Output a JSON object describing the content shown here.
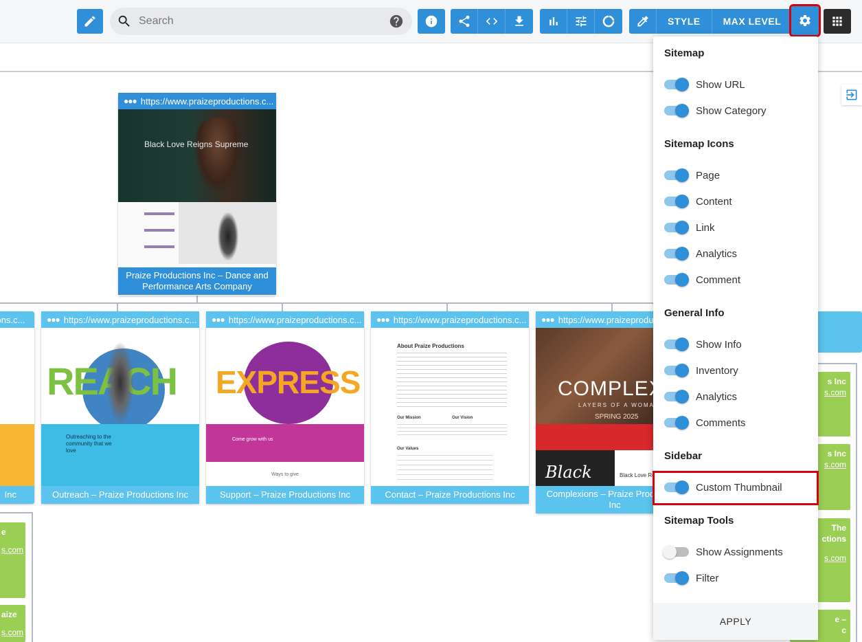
{
  "toolbar": {
    "search_placeholder": "Search",
    "style_label": "STYLE",
    "max_level_label": "MAX LEVEL"
  },
  "root": {
    "url": "https://www.praizeproductions.c...",
    "title": "Praize Productions Inc – Dance and Performance Arts Company",
    "hero_text": "Black Love Reigns Supreme"
  },
  "children": [
    {
      "url": "tions.c...",
      "title": "Inc"
    },
    {
      "url": "https://www.praizeproductions.c...",
      "title": "Outreach – Praize Productions Inc",
      "hero_text": "REACH",
      "sub_text": "Outreaching to the community that we love"
    },
    {
      "url": "https://www.praizeproductions.c...",
      "title": "Support – Praize Productions Inc",
      "hero_text": "EXPRESS",
      "sub_text": "Come grow with us",
      "footer_text": "Ways to give"
    },
    {
      "url": "https://www.praizeproductions.c...",
      "title": "Contact – Praize Productions Inc",
      "heading": "About Praize Productions",
      "mission": "Our Mission",
      "vision": "Our Vision",
      "values": "Our Values"
    },
    {
      "url": "https://www.praizeproductions.c...",
      "title": "Complexions – Praize Productions Inc",
      "hero_text": "COMPLEXIONS",
      "hero_sub": "LAYERS OF A WOMAN",
      "season": "SPRING 2025",
      "black_text": "Black",
      "reigns_text": "Black Love Reigns"
    }
  ],
  "right_cards": [
    {
      "line1": "s Inc",
      "line2": "s.com"
    },
    {
      "line1": "s Inc",
      "line2": "s.com"
    },
    {
      "line1": "The",
      "line2": "ctions",
      "line3": "s.com"
    },
    {
      "line1": "e –",
      "line2": "c"
    }
  ],
  "left_cards": [
    {
      "line1": "e",
      "line2": "s.com"
    },
    {
      "line1": "aize",
      "line2": "s.com"
    }
  ],
  "settings": {
    "sitemap_title": "Sitemap",
    "show_url": "Show URL",
    "show_category": "Show Category",
    "icons_title": "Sitemap Icons",
    "page": "Page",
    "content": "Content",
    "link": "Link",
    "analytics": "Analytics",
    "comment": "Comment",
    "general_title": "General Info",
    "show_info": "Show Info",
    "inventory": "Inventory",
    "analytics2": "Analytics",
    "comments": "Comments",
    "sidebar_title": "Sidebar",
    "custom_thumbnail": "Custom Thumbnail",
    "tools_title": "Sitemap Tools",
    "show_assignments": "Show Assignments",
    "filter": "Filter",
    "apply": "APPLY"
  },
  "colors": {
    "primary": "#2f8fd8",
    "card_blue": "#5bc3ee",
    "green": "#9bce55",
    "highlight": "#d9000d"
  }
}
